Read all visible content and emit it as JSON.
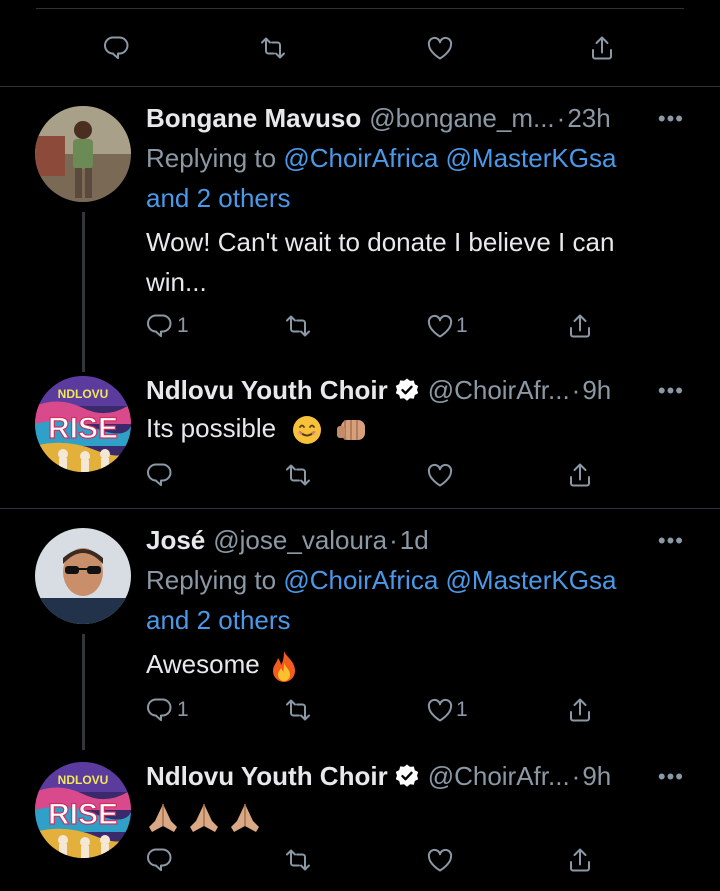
{
  "replies": [
    {
      "name": "Bongane Mavuso",
      "handle": "@bongane_m...",
      "dot": "·",
      "time": "23h",
      "replying_prefix": "Replying to",
      "replying_handles": "@ChoirAfrica @MasterKGsa",
      "replying_others": "and 2 others",
      "text_line1": "Wow! Can't wait to donate I believe I can",
      "text_line2": "win...",
      "reply_count": "1",
      "like_count": "1"
    },
    {
      "name": "Ndlovu Youth Choir",
      "handle": "@ChoirAfr...",
      "dot": "·",
      "time": "9h",
      "verified": true,
      "text": "Its possible",
      "emoji": [
        "smiling-face",
        "fist-bump"
      ]
    },
    {
      "name": "José",
      "handle": "@jose_valoura",
      "dot": "·",
      "time": "1d",
      "replying_prefix": "Replying to",
      "replying_handles": "@ChoirAfrica @MasterKGsa",
      "replying_others": "and 2 others",
      "text": "Awesome",
      "emoji": [
        "fire"
      ],
      "reply_count": "1",
      "like_count": "1"
    },
    {
      "name": "Ndlovu Youth Choir",
      "handle": "@ChoirAfr...",
      "dot": "·",
      "time": "9h",
      "verified": true,
      "emoji": [
        "folded-hands",
        "folded-hands",
        "folded-hands"
      ]
    }
  ],
  "more_glyph": "•••",
  "avatar_text": "NDLOVU",
  "colors": {
    "background": "#000000",
    "text": "#e7e9ea",
    "muted": "#8b98a5",
    "link": "#4a99e9",
    "divider": "#2f3336",
    "verified": "#ffffff"
  }
}
